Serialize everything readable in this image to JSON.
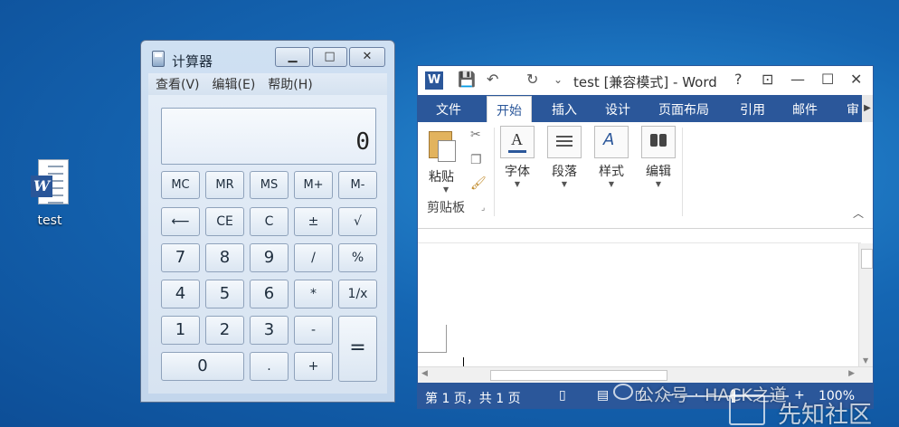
{
  "desktop": {
    "icon_label": "test"
  },
  "calculator": {
    "title": "计算器",
    "window_buttons": [
      "▁",
      "□",
      "✕"
    ],
    "menu": [
      "查看(V)",
      "编辑(E)",
      "帮助(H)"
    ],
    "display_value": "0",
    "keys": {
      "mc": "MC",
      "mr": "MR",
      "ms": "MS",
      "mplus": "M+",
      "mminus": "M-",
      "back": "⟵",
      "ce": "CE",
      "c": "C",
      "plusminus": "±",
      "sqrt": "√",
      "k7": "7",
      "k8": "8",
      "k9": "9",
      "div": "/",
      "pct": "%",
      "k4": "4",
      "k5": "5",
      "k6": "6",
      "mul": "*",
      "inv": "1/x",
      "k1": "1",
      "k2": "2",
      "k3": "3",
      "sub": "-",
      "eq": "=",
      "k0": "0",
      "dot": ".",
      "add": "+"
    }
  },
  "word": {
    "title": "test [兼容模式] - Word",
    "title_buttons": {
      "help": "?",
      "ribbon_opts": "⊡",
      "minimize": "—",
      "maximize": "☐",
      "close": "✕"
    },
    "qat": {
      "save": "💾",
      "undo": "↶",
      "redo": "↻",
      "customize": "⌄"
    },
    "tabs": [
      "文件",
      "开始",
      "插入",
      "设计",
      "页面布局",
      "引用",
      "邮件",
      "审"
    ],
    "active_tab": "开始",
    "ribbon": {
      "paste_label": "粘贴",
      "clipboard_group": "剪贴板",
      "font_label": "字体",
      "paragraph_label": "段落",
      "styles_label": "样式",
      "editing_label": "编辑"
    },
    "status": {
      "page_info": "第 1 页，共 1 页",
      "zoom_minus": "−",
      "zoom_plus": "+",
      "zoom": "100%"
    }
  },
  "watermark": {
    "line1": "公众号 · HACK之道",
    "line2": "先知社区"
  }
}
